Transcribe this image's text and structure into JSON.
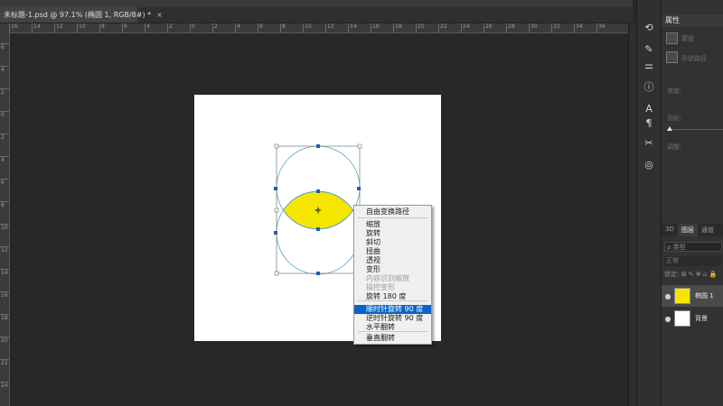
{
  "document_tab": {
    "title": "未标题-1.psd @ 97.1% (椭圆 1, RGB/8#) *",
    "close_glyph": "×"
  },
  "ruler": {
    "h_labels": [
      "16",
      "14",
      "12",
      "10",
      "8",
      "6",
      "4",
      "2",
      "0",
      "2",
      "4",
      "6",
      "8",
      "10",
      "12",
      "14",
      "16",
      "18",
      "20",
      "22",
      "24",
      "26",
      "28",
      "30",
      "32",
      "34",
      "36"
    ],
    "v_labels": [
      "6",
      "4",
      "2",
      "0",
      "2",
      "4",
      "6",
      "8",
      "10",
      "12",
      "14",
      "16",
      "18",
      "20",
      "22",
      "24"
    ]
  },
  "properties_panel": {
    "title": "属性",
    "mask_label": "蒙版",
    "shape_label": "形状路径",
    "density_label": "浓度:",
    "feather_label": "羽化:",
    "refine_label": "调整:"
  },
  "layers_panel": {
    "tabs": [
      "3D",
      "图层",
      "通道"
    ],
    "active_tab": "图层",
    "search_placeholder": "ρ 类型",
    "blend_mode": "正常",
    "lock_label": "锁定:",
    "layers": [
      {
        "name": "椭圆 1",
        "selected": true,
        "visible": true
      },
      {
        "name": "背景",
        "selected": false,
        "visible": true
      }
    ]
  },
  "context_menu": {
    "items": [
      {
        "label": "自由变换路径",
        "disabled": false,
        "highlighted": false
      },
      {
        "label": "缩放",
        "disabled": false,
        "highlighted": false
      },
      {
        "label": "旋转",
        "disabled": false,
        "highlighted": false
      },
      {
        "label": "斜切",
        "disabled": false,
        "highlighted": false
      },
      {
        "label": "扭曲",
        "disabled": false,
        "highlighted": false
      },
      {
        "label": "透视",
        "disabled": false,
        "highlighted": false
      },
      {
        "label": "变形",
        "disabled": false,
        "highlighted": false
      },
      {
        "label": "内容识别缩放",
        "disabled": true,
        "highlighted": false
      },
      {
        "label": "操控变形",
        "disabled": true,
        "highlighted": false
      },
      {
        "label": "旋转 180 度",
        "disabled": false,
        "highlighted": false
      },
      {
        "label": "顺时针旋转 90 度",
        "disabled": false,
        "highlighted": true
      },
      {
        "label": "逆时针旋转 90 度",
        "disabled": false,
        "highlighted": false
      },
      {
        "label": "水平翻转",
        "disabled": false,
        "highlighted": false
      },
      {
        "label": "垂直翻转",
        "disabled": false,
        "highlighted": false
      }
    ]
  },
  "colors": {
    "shape_fill": "#f5e600",
    "path_stroke": "#5aa0c8",
    "menu_highlight": "#0a64c8",
    "workspace_bg": "#282828"
  },
  "icons": [
    "history-icon",
    "brush-icon",
    "adjust-icon",
    "info-icon",
    "text-icon",
    "paragraph-icon",
    "tools-icon",
    "lens-icon",
    "mask-icon",
    "lock-icon"
  ]
}
